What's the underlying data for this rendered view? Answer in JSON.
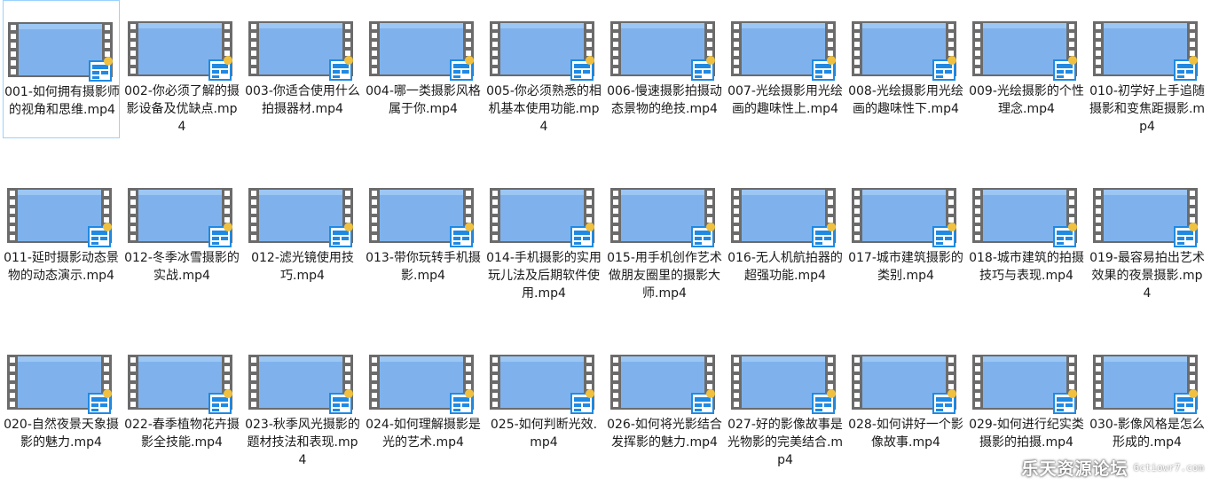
{
  "files": [
    {
      "name": "001-如何拥有摄影师的视角和思维.mp4",
      "selected": true
    },
    {
      "name": "002-你必须了解的摄影设备及优缺点.mp4"
    },
    {
      "name": "003-你适合使用什么拍摄器材.mp4"
    },
    {
      "name": "004-哪一类摄影风格属于你.mp4"
    },
    {
      "name": "005-你必须熟悉的相机基本使用功能.mp4"
    },
    {
      "name": "006-慢速摄影拍摄动态景物的绝技.mp4"
    },
    {
      "name": "007-光绘摄影用光绘画的趣味性上.mp4"
    },
    {
      "name": "008-光绘摄影用光绘画的趣味性下.mp4"
    },
    {
      "name": "009-光绘摄影的个性理念.mp4"
    },
    {
      "name": "010-初学好上手追随摄影和变焦距摄影.mp4"
    },
    {
      "name": "011-延时摄影动态景物的动态演示.mp4"
    },
    {
      "name": "012-冬季冰雪摄影的实战.mp4"
    },
    {
      "name": "012-滤光镜使用技巧.mp4"
    },
    {
      "name": "013-带你玩转手机摄影.mp4"
    },
    {
      "name": "014-手机摄影的实用玩儿法及后期软件使用.mp4"
    },
    {
      "name": "015-用手机创作艺术做朋友圈里的摄影大师.mp4"
    },
    {
      "name": "016-无人机航拍器的超强功能.mp4"
    },
    {
      "name": "017-城市建筑摄影的类别.mp4"
    },
    {
      "name": "018-城市建筑的拍摄技巧与表现.mp4"
    },
    {
      "name": "019-最容易拍出艺术效果的夜景摄影.mp4"
    },
    {
      "name": "020-自然夜景天象摄影的魅力.mp4"
    },
    {
      "name": "022-春季植物花卉摄影全技能.mp4"
    },
    {
      "name": "023-秋季风光摄影的题材技法和表现.mp4"
    },
    {
      "name": "024-如何理解摄影是光的艺术.mp4"
    },
    {
      "name": "025-如何判断光效.mp4"
    },
    {
      "name": "026-如何将光影结合发挥影的魅力.mp4"
    },
    {
      "name": "027-好的影像故事是光物影的完美结合.mp4"
    },
    {
      "name": "028-如何讲好一个影像故事.mp4"
    },
    {
      "name": "029-如何进行纪实类摄影的拍摄.mp4"
    },
    {
      "name": "030-影像风格是怎么形成的.mp4"
    }
  ],
  "icon": {
    "type": "video-file-icon",
    "screen_color": "#7fb2ec",
    "film_color": "#6b6b6b",
    "badge_color": "#1f8ae3"
  },
  "watermark": {
    "text": "乐天资源论坛",
    "url": "6ctiowr7.com"
  }
}
